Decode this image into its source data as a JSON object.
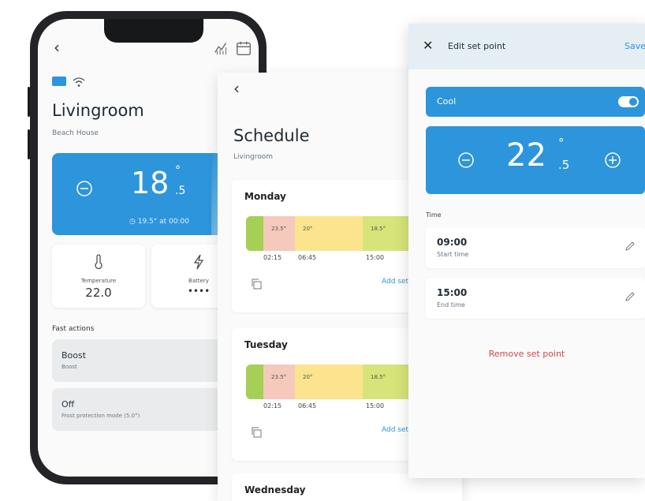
{
  "phone": {
    "room": "Livingroom",
    "location": "Beach House",
    "current_temp": {
      "whole": "18",
      "degree": "°",
      "decimal": ".5"
    },
    "temp_note": "19.5° at 00:00",
    "stats": [
      {
        "label": "Temperature",
        "value": "22.0"
      },
      {
        "label": "Battery",
        "value": "••••"
      }
    ],
    "fast_actions_title": "Fast actions",
    "actions": [
      {
        "title": "Boost",
        "subtitle": "Boost"
      },
      {
        "title": "Off",
        "subtitle": "Frost protection mode (5.0°)"
      }
    ]
  },
  "schedule": {
    "title": "Schedule",
    "room": "Livingroom",
    "days": [
      {
        "name": "Monday",
        "temps": [
          "23.5°",
          "20°",
          "18.5°"
        ],
        "times": [
          "02:15",
          "06:45",
          "15:00"
        ],
        "add_label": "Add set point"
      },
      {
        "name": "Tuesday",
        "temps": [
          "23.5°",
          "20°",
          "18.5°"
        ],
        "times": [
          "02:15",
          "06:45",
          "15:00"
        ],
        "add_label": "Add set point"
      },
      {
        "name": "Wednesday"
      }
    ]
  },
  "edit": {
    "title": "Edit set point",
    "save_label": "Save",
    "mode_label": "Cool",
    "mode_on": true,
    "setpoint": {
      "whole": "22",
      "degree": "°",
      "decimal": ".5"
    },
    "time_section_label": "Time",
    "start": {
      "value": "09:00",
      "label": "Start time"
    },
    "end": {
      "value": "15:00",
      "label": "End time"
    },
    "remove_label": "Remove set point"
  },
  "colors": {
    "accent": "#2d95db",
    "seg_red": "#f6c9bd",
    "seg_yellow": "#fbe48d",
    "seg_olive": "#d7e47a",
    "seg_green": "#a5cf55",
    "danger": "#d64545"
  }
}
